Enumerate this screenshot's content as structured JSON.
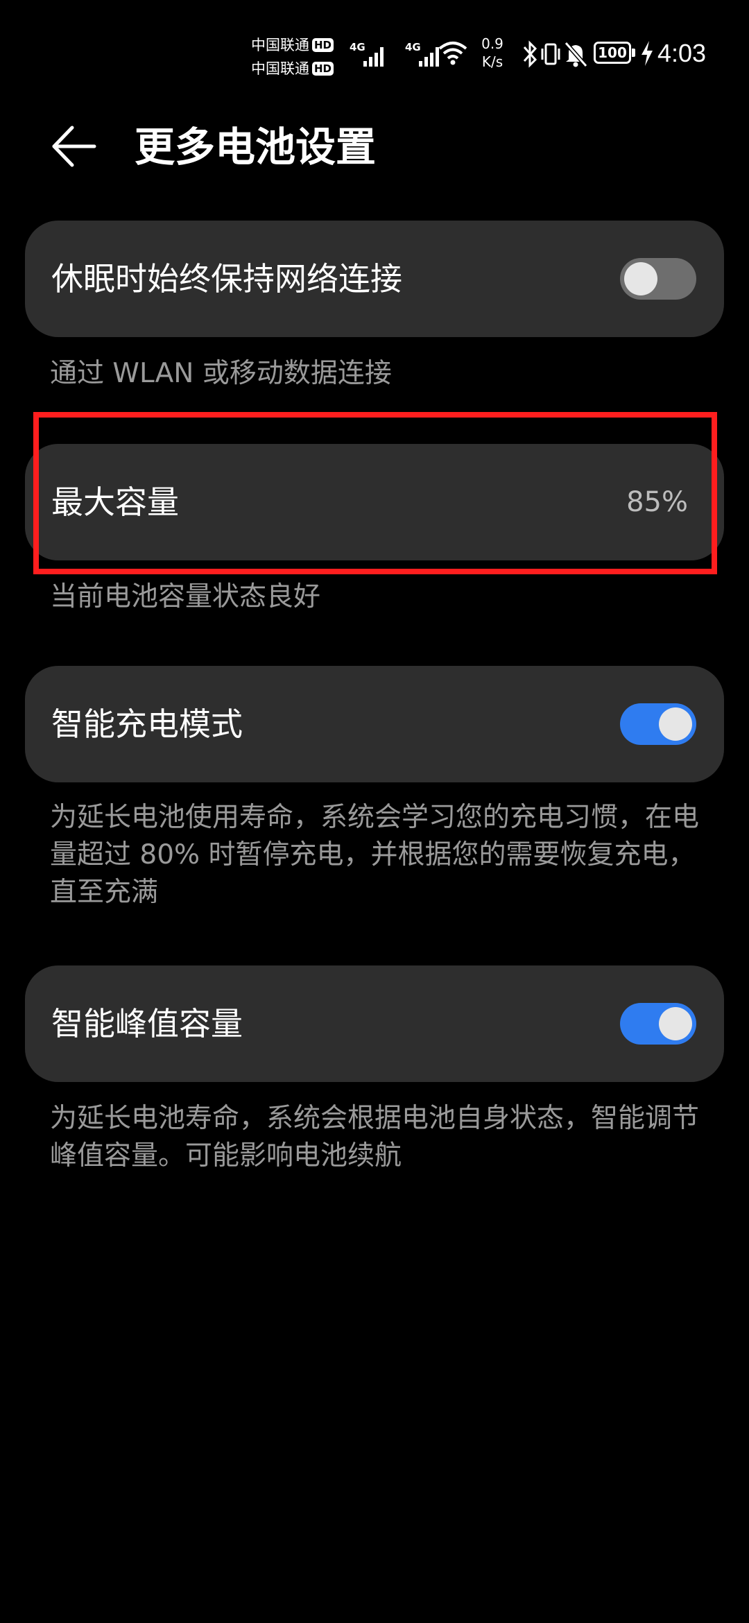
{
  "status_bar": {
    "carrier_1": "中国联通",
    "carrier_2": "中国联通",
    "hd_badge": "HD",
    "sim1_tech": "4G",
    "sim2_tech": "4G",
    "net_speed_value": "0.9",
    "net_speed_unit": "K/s",
    "battery_level": "100",
    "time": "4:03",
    "icons": [
      "signal-icon",
      "wifi-icon",
      "bluetooth-icon",
      "vibrate-icon",
      "bell-off-icon",
      "battery-icon",
      "charging-icon"
    ]
  },
  "header": {
    "back_icon": "arrow-left-icon",
    "title": "更多电池设置"
  },
  "settings": [
    {
      "label": "休眠时始终保持网络连接",
      "toggle": "off",
      "description": "通过 WLAN 或移动数据连接"
    },
    {
      "label": "最大容量",
      "value": "85%",
      "description": "当前电池容量状态良好"
    },
    {
      "label": "智能充电模式",
      "toggle": "on",
      "description": "为延长电池使用寿命，系统会学习您的充电习惯，在电量超过 80% 时暂停充电，并根据您的需要恢复充电，直至充满"
    },
    {
      "label": "智能峰值容量",
      "toggle": "on",
      "description": "为延长电池寿命，系统会根据电池自身状态，智能调节峰值容量。可能影响电池续航"
    }
  ],
  "colors": {
    "background": "#000000",
    "card": "#2e2e2e",
    "toggle_on": "#2f7cf0",
    "toggle_off": "#6e6e6e",
    "highlight_box": "#ff1e1e",
    "secondary_text": "#9a9a9a"
  }
}
